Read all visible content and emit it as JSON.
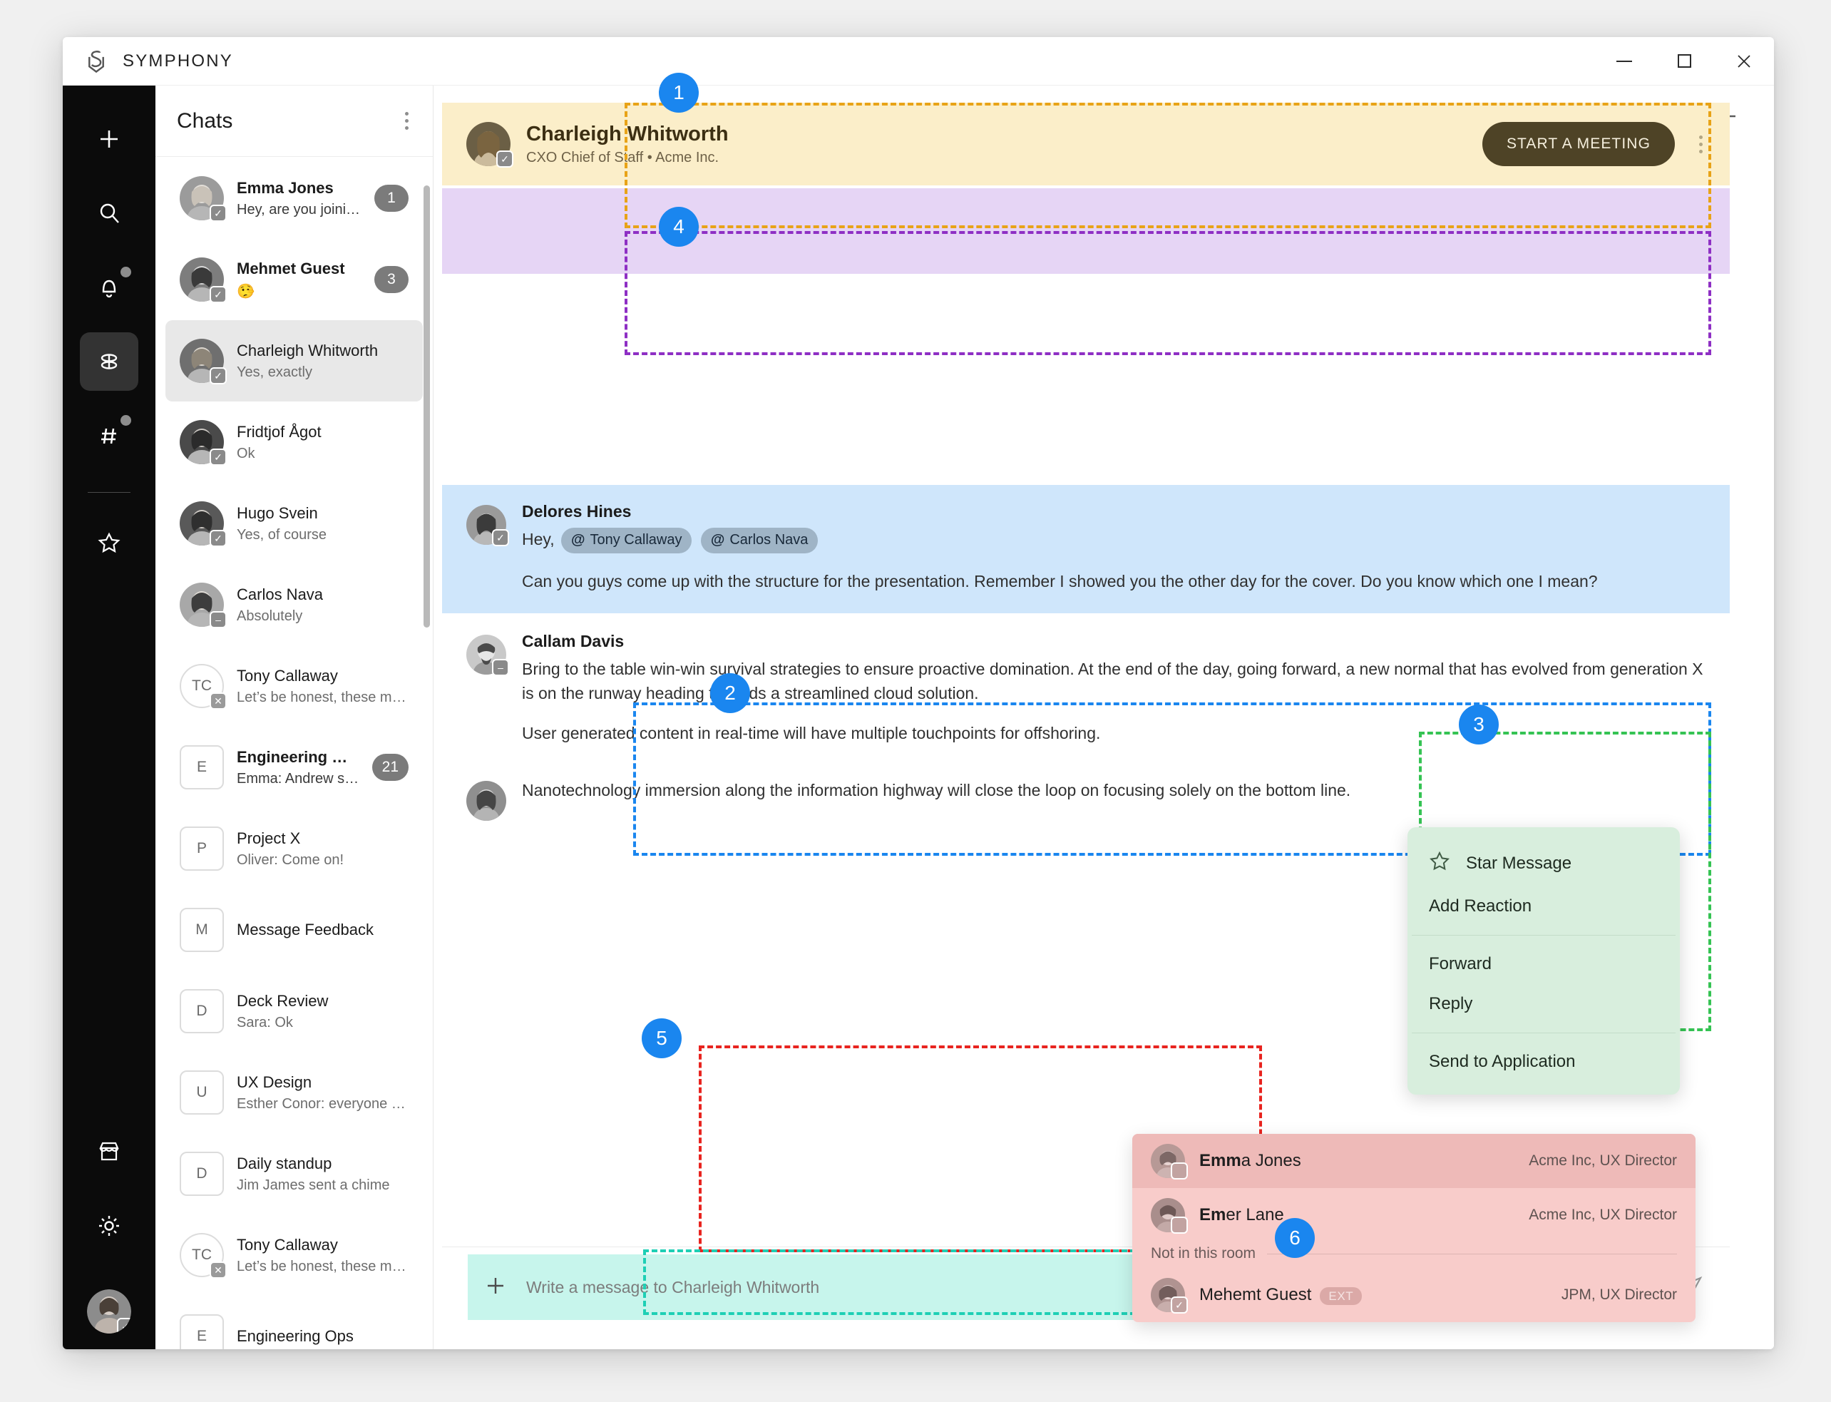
{
  "window": {
    "brand": "SYMPHONY",
    "controls": {
      "minimize": "minimize-icon",
      "maximize": "maximize-icon",
      "close": "close-icon"
    }
  },
  "rail": {
    "items": [
      {
        "icon": "plus-icon",
        "name": "create"
      },
      {
        "icon": "search-icon",
        "name": "search"
      },
      {
        "icon": "bell-icon",
        "name": "notifications",
        "dot": true
      },
      {
        "icon": "chats-icon",
        "name": "chats",
        "active": true
      },
      {
        "icon": "hash-icon",
        "name": "rooms",
        "dot": true
      },
      {
        "icon": "star-icon",
        "name": "starred"
      }
    ],
    "bottom": [
      {
        "icon": "market-icon",
        "name": "marketplace"
      },
      {
        "icon": "gear-icon",
        "name": "settings"
      }
    ]
  },
  "chatlist": {
    "title": "Chats",
    "menu_icon": "kebab-icon",
    "items": [
      {
        "name": "Emma Jones",
        "preview": "Hey, are you joining the meeting?",
        "badge": "1",
        "avatar": "photo",
        "presence": "available",
        "unread": true
      },
      {
        "name": "Mehmet Guest",
        "preview": "🤥",
        "badge": "3",
        "avatar": "photo",
        "presence": "available",
        "unread": true
      },
      {
        "name": "Charleigh Whitworth",
        "preview": "Yes, exactly",
        "badge": "",
        "avatar": "photo",
        "presence": "available",
        "selected": true
      },
      {
        "name": "Fridtjof Ågot",
        "preview": "Ok",
        "badge": "",
        "avatar": "photo",
        "presence": "available"
      },
      {
        "name": "Hugo Svein",
        "preview": "Yes, of course",
        "badge": "",
        "avatar": "photo",
        "presence": "available"
      },
      {
        "name": "Carlos Nava",
        "preview": "Absolutely",
        "badge": "",
        "avatar": "photo",
        "presence": "busy"
      },
      {
        "name": "Tony Callaway",
        "preview": "Let’s be honest, these mockups look gre...",
        "badge": "",
        "avatar": "initials",
        "initials": "TC",
        "presence": "offline"
      },
      {
        "name": "Engineering Ops",
        "preview": "Emma: Andrew should know, pass...",
        "badge": "21",
        "avatar": "square",
        "initials": "E",
        "unread": true
      },
      {
        "name": "Project X",
        "preview": "Oliver: Come on!",
        "badge": "",
        "avatar": "square",
        "initials": "P"
      },
      {
        "name": "Message Feedback",
        "preview": "",
        "badge": "",
        "avatar": "square",
        "initials": "M"
      },
      {
        "name": "Deck Review",
        "preview": "Sara: Ok",
        "badge": "",
        "avatar": "square",
        "initials": "D"
      },
      {
        "name": "UX Design",
        "preview": "Esther Conor: everyone take the poll!",
        "badge": "",
        "avatar": "square",
        "initials": "U"
      },
      {
        "name": "Daily standup",
        "preview": "Jim James sent a chime",
        "badge": "",
        "avatar": "square",
        "initials": "D"
      },
      {
        "name": "Tony Callaway",
        "preview": "Let’s be honest, these mockups look great!",
        "badge": "",
        "avatar": "initials",
        "initials": "TC",
        "presence": "offline"
      },
      {
        "name": "Engineering Ops",
        "preview": "",
        "badge": "",
        "avatar": "square",
        "initials": "E"
      }
    ]
  },
  "conversation": {
    "add_icon": "plus-icon",
    "header": {
      "name": "Charleigh Whitworth",
      "subtitle": "CXO Chief of Staff • Acme Inc.",
      "start_meeting_label": "START A MEETING",
      "menu_icon": "kebab-icon"
    },
    "messages": [
      {
        "author": "Delores Hines",
        "highlight": "blue",
        "lines": [
          {
            "prefix": "Hey,",
            "mentions": [
              "Tony Callaway",
              "Carlos Nava"
            ]
          },
          {
            "text": "Can you guys come up with the structure for the presentation. Remember I showed you the other day for the cover. Do you know which one I mean?"
          }
        ]
      },
      {
        "author": "Callam Davis",
        "lines": [
          {
            "text": "Bring to the table win-win survival strategies to ensure proactive domination. At the end of the day, going forward, a new normal that has evolved from generation X is on the runway heading towards a streamlined cloud solution."
          },
          {
            "text": "User generated content in real-time will have multiple touchpoints for offshoring."
          }
        ]
      },
      {
        "author": "",
        "lines": [
          {
            "text": "Nanotechnology immersion along the information highway will close the loop on focusing solely on the bottom line."
          }
        ]
      }
    ],
    "context_menu": {
      "items": [
        {
          "label": "Star Message",
          "icon": "star-icon"
        },
        {
          "label": "Add Reaction",
          "icon": ""
        },
        {
          "label": "Forward",
          "icon": ""
        },
        {
          "label": "Reply",
          "icon": ""
        },
        {
          "label": "Send to Application",
          "icon": ""
        }
      ]
    },
    "mention_popup": {
      "section_label": "Not in this room",
      "in_room": [
        {
          "name_bold": "Emm",
          "name_rest": "a Jones",
          "meta": "Acme Inc, UX Director",
          "highlighted": true
        },
        {
          "name_bold": "Em",
          "name_rest": "er Lane",
          "meta": "Acme Inc, UX Director"
        }
      ],
      "not_in_room": [
        {
          "name_bold": "",
          "name_rest": "Mehemt Guest",
          "meta": "JPM, UX Director",
          "ext": "EXT"
        }
      ]
    },
    "composer": {
      "plus_icon": "plus-icon",
      "placeholder": "Write a message to Charleigh Whitworth",
      "attach_icon": "paperclip-icon",
      "emoji_icon": "emoji-icon",
      "send_icon": "send-icon"
    }
  },
  "annotations": {
    "steps": [
      "1",
      "2",
      "3",
      "4",
      "5",
      "6"
    ],
    "colors": {
      "step_badge": "#1a86ef",
      "box1_border": "#e8a317",
      "box1_fill": "#fbeec9",
      "box2_border": "#1a86ef",
      "box2_fill": "#cfe6fb",
      "box3_border": "#35c353",
      "box3_fill": "#d8eedd",
      "box4_border": "#8e2fc4",
      "box4_fill": "#e6d5f5",
      "box5_border": "#e8241f",
      "box5_fill": "#f8ccca",
      "box6_border": "#1ecfb5",
      "box6_fill": "#c7f5ec"
    }
  }
}
